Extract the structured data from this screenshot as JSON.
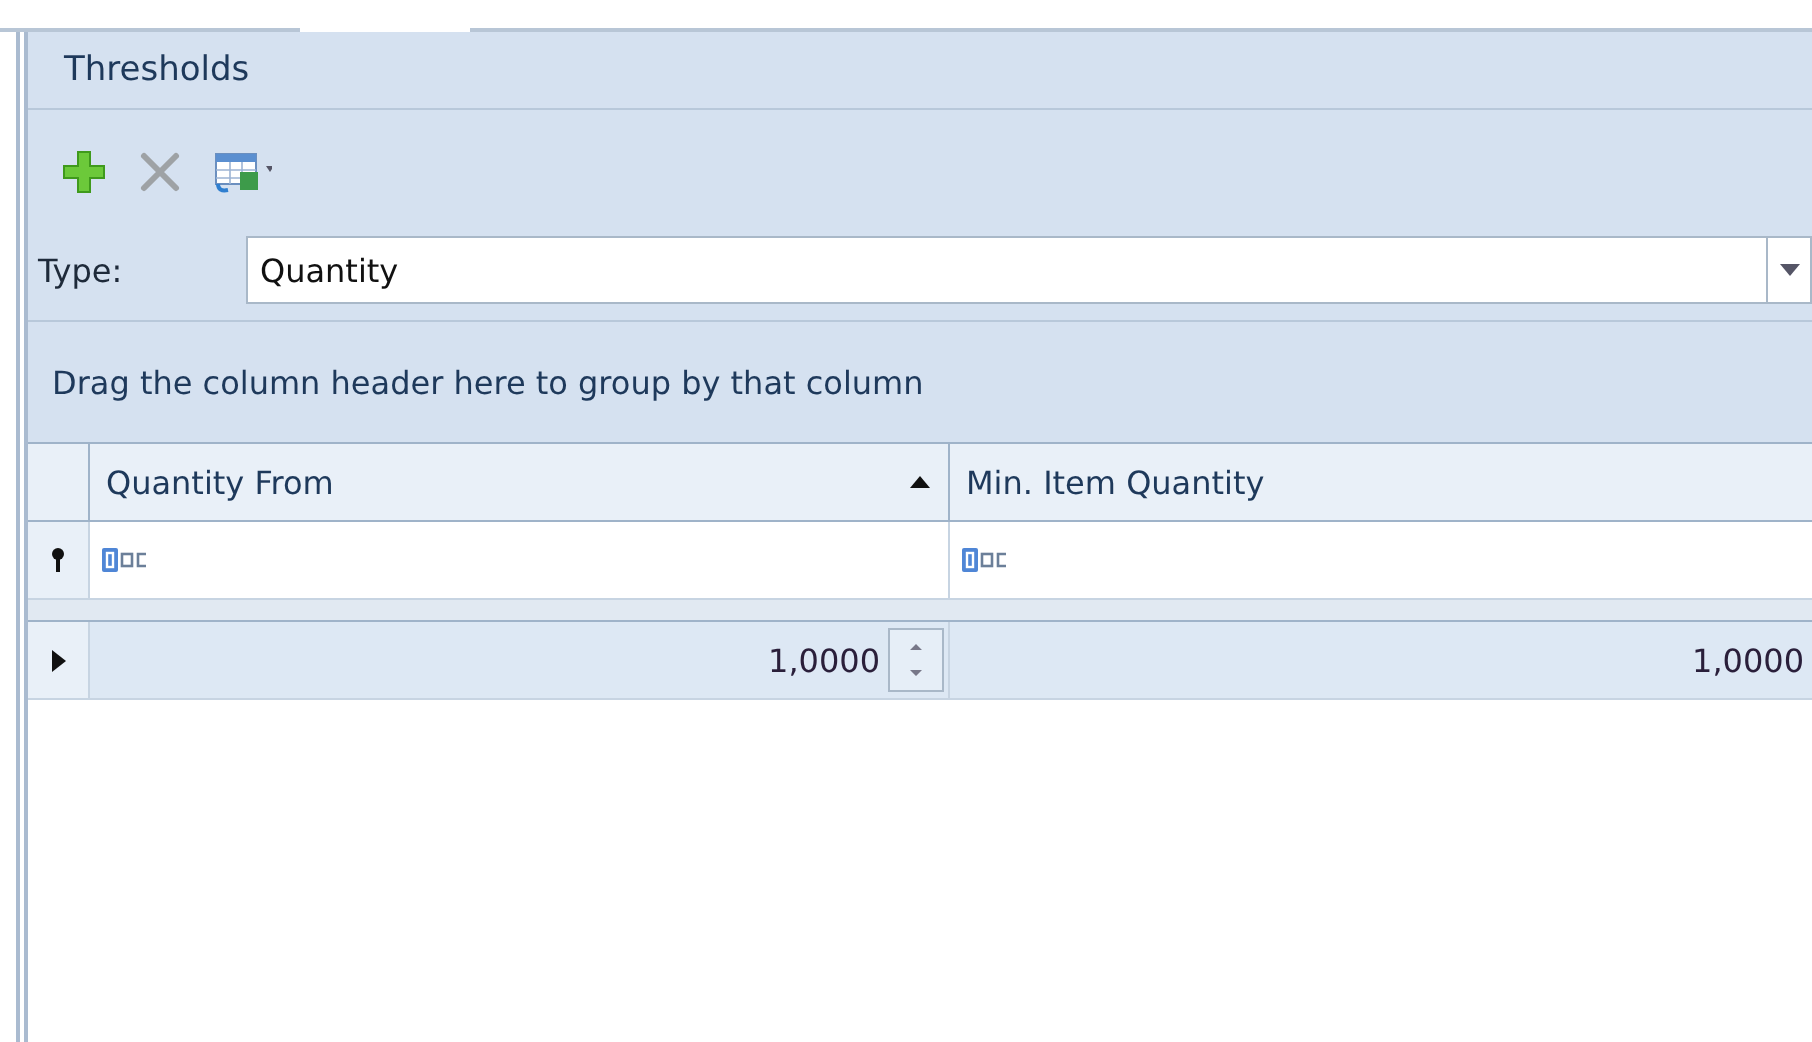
{
  "panel": {
    "title": "Thresholds"
  },
  "toolbar": [
    {
      "kind": "add",
      "disabled": false
    },
    {
      "kind": "delete",
      "disabled": true
    },
    {
      "kind": "export",
      "disabled": false
    }
  ],
  "type_field": {
    "label": "Type:",
    "value": "Quantity"
  },
  "grid": {
    "group_panel_hint": "Drag the column header here to group by that column",
    "columns": [
      {
        "label": "Quantity From",
        "sorted_ascending": true
      },
      {
        "label": "Min. Item Quantity",
        "sorted_ascending": false
      }
    ],
    "rows": [
      {
        "selected": true,
        "cells": [
          {
            "value": "1,0000",
            "editing": true
          },
          {
            "value": "1,0000",
            "editing": false
          }
        ]
      }
    ]
  }
}
